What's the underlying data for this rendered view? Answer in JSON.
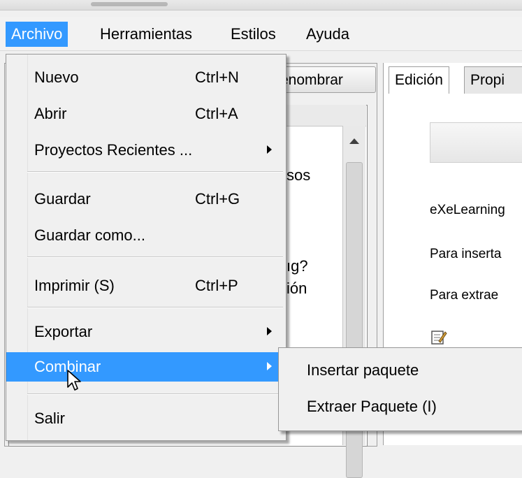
{
  "menubar": {
    "items": [
      "Archivo",
      "Herramientas",
      "Estilos",
      "Ayuda"
    ]
  },
  "background": {
    "rename_button": "enombrar",
    "left_fragments": [
      "sos",
      "ıg?",
      "ión"
    ],
    "tabs": [
      "Edición",
      "Propi"
    ],
    "right_lines": [
      "eXeLearning",
      "Para inserta",
      "Para extrae"
    ]
  },
  "menu": {
    "items": [
      {
        "label": "Nuevo",
        "shortcut": "Ctrl+N"
      },
      {
        "label": "Abrir",
        "shortcut": "Ctrl+A"
      },
      {
        "label": "Proyectos Recientes ...",
        "shortcut": ""
      },
      {
        "label": "Guardar",
        "shortcut": "Ctrl+G"
      },
      {
        "label": "Guardar como...",
        "shortcut": ""
      },
      {
        "label": "Imprimir (S)",
        "shortcut": "Ctrl+P"
      },
      {
        "label": "Exportar",
        "shortcut": ""
      },
      {
        "label": "Combinar",
        "shortcut": ""
      },
      {
        "label": "Salir",
        "shortcut": ""
      }
    ]
  },
  "submenu": {
    "items": [
      "Insertar paquete",
      "Extraer Paquete (I)"
    ]
  },
  "colors": {
    "highlight": "#3399ff",
    "menu_bg": "#f0f0f0"
  }
}
